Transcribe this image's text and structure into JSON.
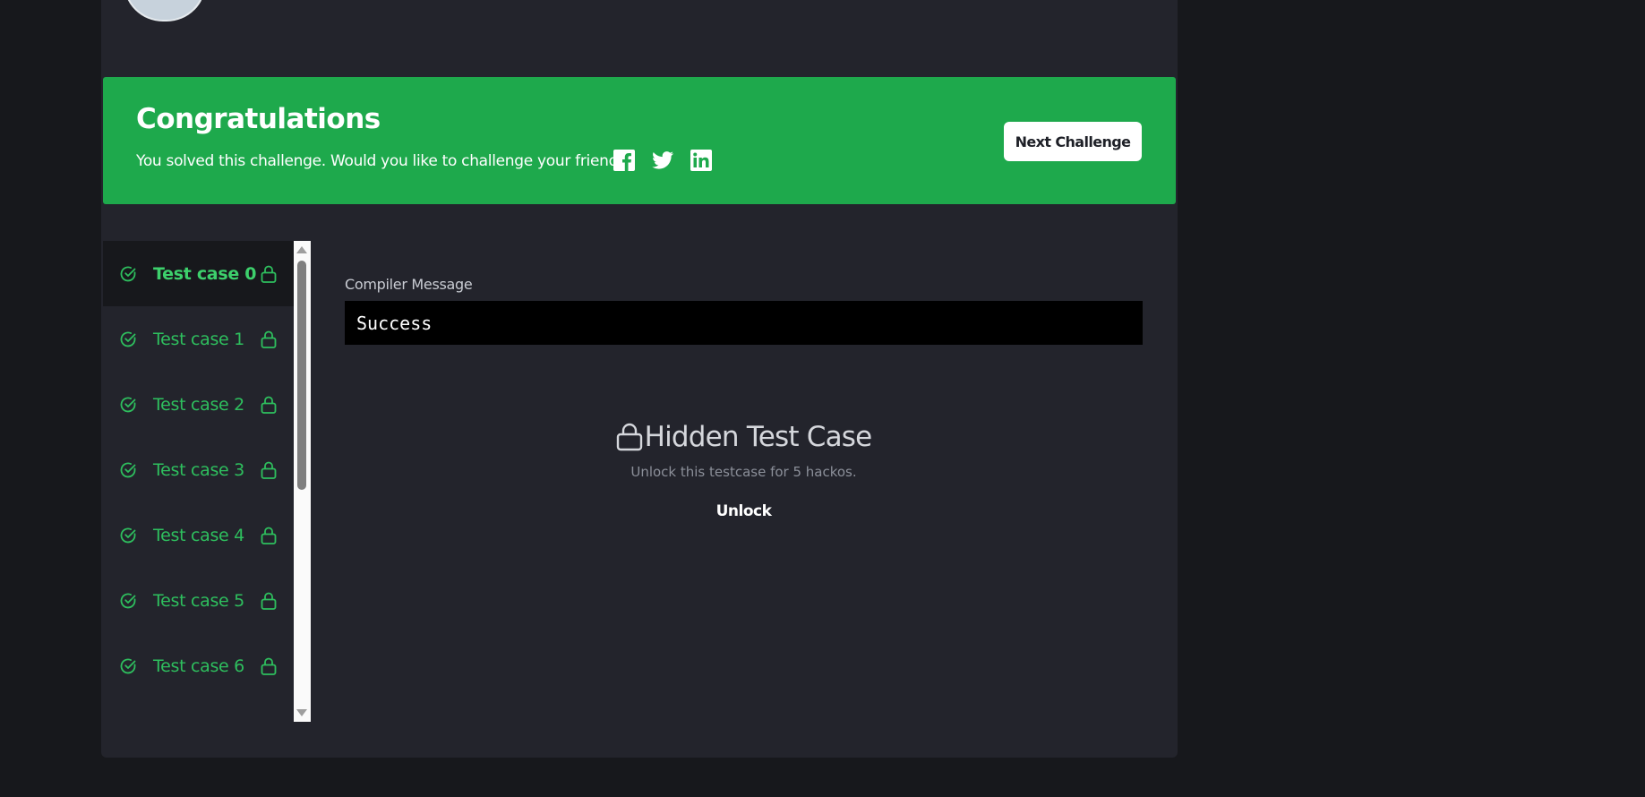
{
  "banner": {
    "title": "Congratulations",
    "message": "You solved this challenge. Would you like to challenge your friends?",
    "social_icons": [
      "facebook-icon",
      "twitter-icon",
      "linkedin-icon"
    ],
    "next_button": "Next Challenge",
    "background_color": "#1ea94c"
  },
  "test_cases": [
    {
      "label": "Test case 0",
      "active": true
    },
    {
      "label": "Test case 1",
      "active": false
    },
    {
      "label": "Test case 2",
      "active": false
    },
    {
      "label": "Test case 3",
      "active": false
    },
    {
      "label": "Test case 4",
      "active": false
    },
    {
      "label": "Test case 5",
      "active": false
    },
    {
      "label": "Test case 6",
      "active": false
    }
  ],
  "compiler": {
    "label": "Compiler Message",
    "message": "Success"
  },
  "hidden_case": {
    "title": "Hidden Test Case",
    "subtitle": "Unlock this testcase for 5 hackos.",
    "unlock_label": "Unlock"
  },
  "colors": {
    "accent_green": "#2ebf5e",
    "panel_bg": "#23242c",
    "page_bg": "#17181c"
  }
}
